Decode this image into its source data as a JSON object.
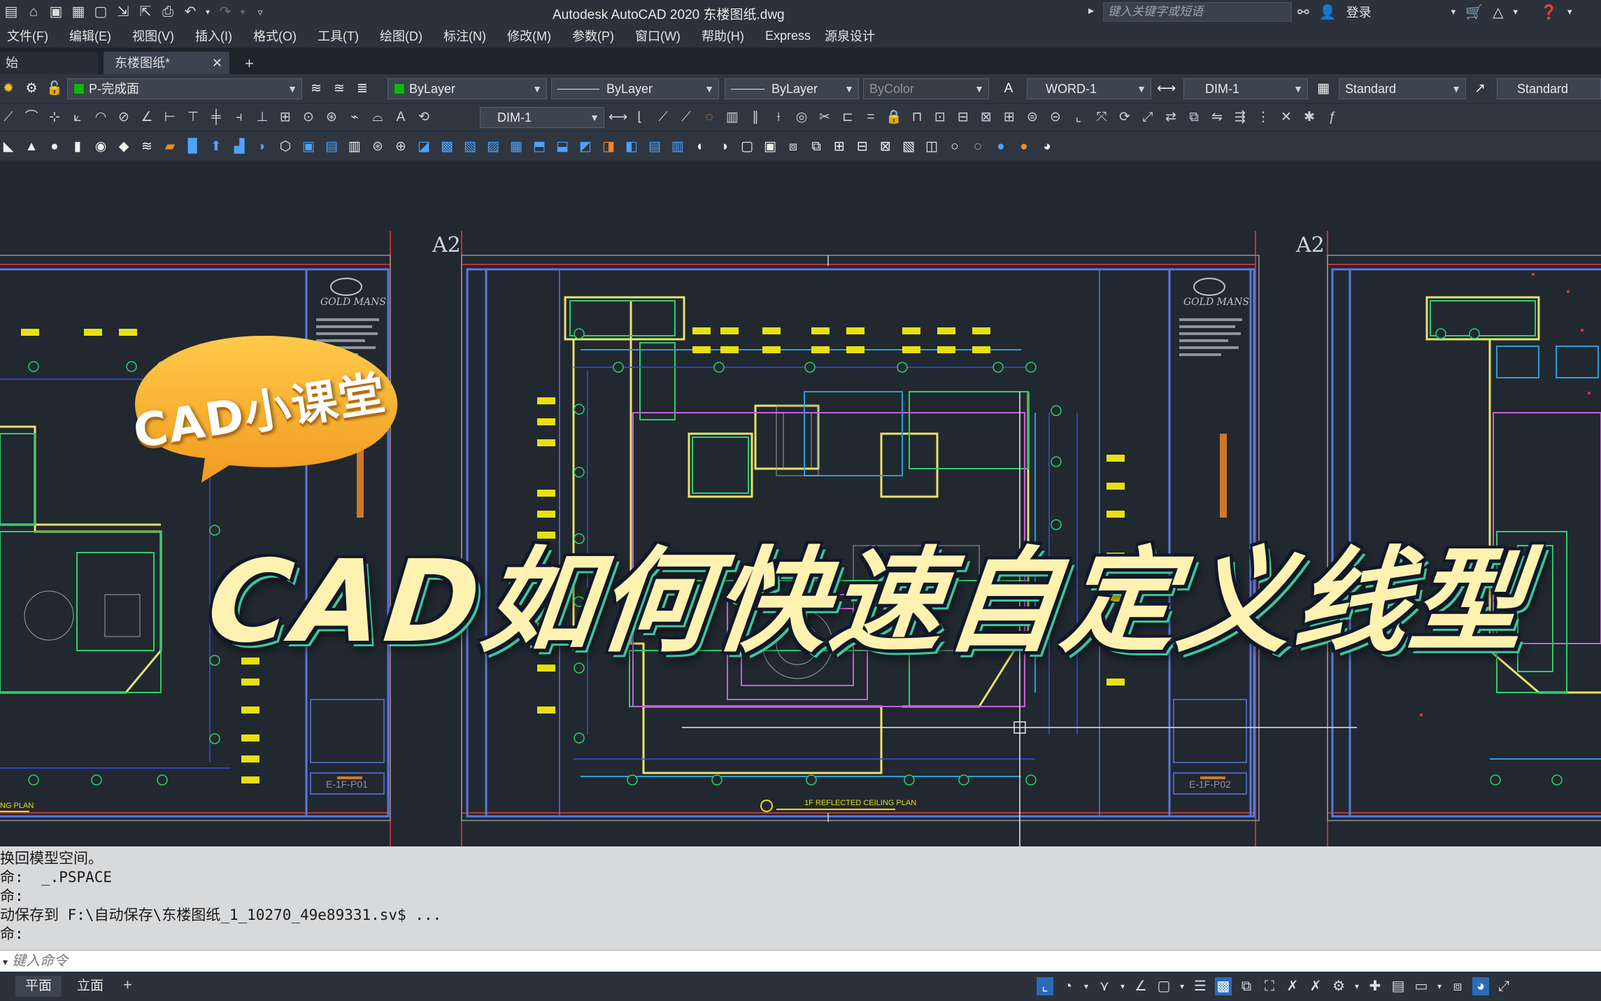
{
  "titlebar": {
    "title": "Autodesk AutoCAD 2020    东楼图纸.dwg",
    "search_placeholder": "键入关键字或短语",
    "login_label": "登录",
    "quick_access_icons": [
      "new-icon",
      "open-icon",
      "save-icon",
      "save-as-icon",
      "plot-preview-icon",
      "import-icon",
      "export-icon",
      "print-icon",
      "undo-icon",
      "redo-icon",
      "customize-icon"
    ]
  },
  "menu": {
    "items": [
      "文件(F)",
      "编辑(E)",
      "视图(V)",
      "插入(I)",
      "格式(O)",
      "工具(T)",
      "绘图(D)",
      "标注(N)",
      "修改(M)",
      "参数(P)",
      "窗口(W)",
      "帮助(H)",
      "Express",
      "源泉设计"
    ]
  },
  "file_tabs": {
    "start_tab": "始",
    "active_tab": "东楼图纸*"
  },
  "properties_toolbar": {
    "layer": "P-完成面",
    "color": "ByLayer",
    "linetype": "ByLayer",
    "lineweight": "ByLayer",
    "plotstyle": "ByColor",
    "text_style": "WORD-1",
    "dim_style": "DIM-1",
    "table_style": "Standard",
    "multileader_style": "Standard",
    "dim_style_2": "DIM-1"
  },
  "drawing": {
    "sheet_labels": [
      "A2",
      "A2"
    ],
    "sheet_codes": [
      "E-1F-P01",
      "E-1F-P02"
    ],
    "plan_title": "1F REFLECTED CEILING PLAN",
    "left_plan_title": "NG PLAN",
    "logo_text": "GOLD MANS"
  },
  "overlay": {
    "bubble_text": "CAD小课堂",
    "main_title": "CAD如何快速自定义线型"
  },
  "command": {
    "history": [
      "换回模型空间。",
      "命:  _.PSPACE",
      "命:",
      "动保存到 F:\\自动保存\\东楼图纸_1_10270_49e89331.sv$ ...",
      "命:"
    ],
    "input_placeholder": "键入命令"
  },
  "status": {
    "layout_tabs": [
      "平面",
      "立面"
    ]
  },
  "colors": {
    "canvas_bg": "#212830",
    "frame_blue": "#5a78e0",
    "wall_yellow": "#f0e020",
    "accent_green": "#2bd06a"
  }
}
